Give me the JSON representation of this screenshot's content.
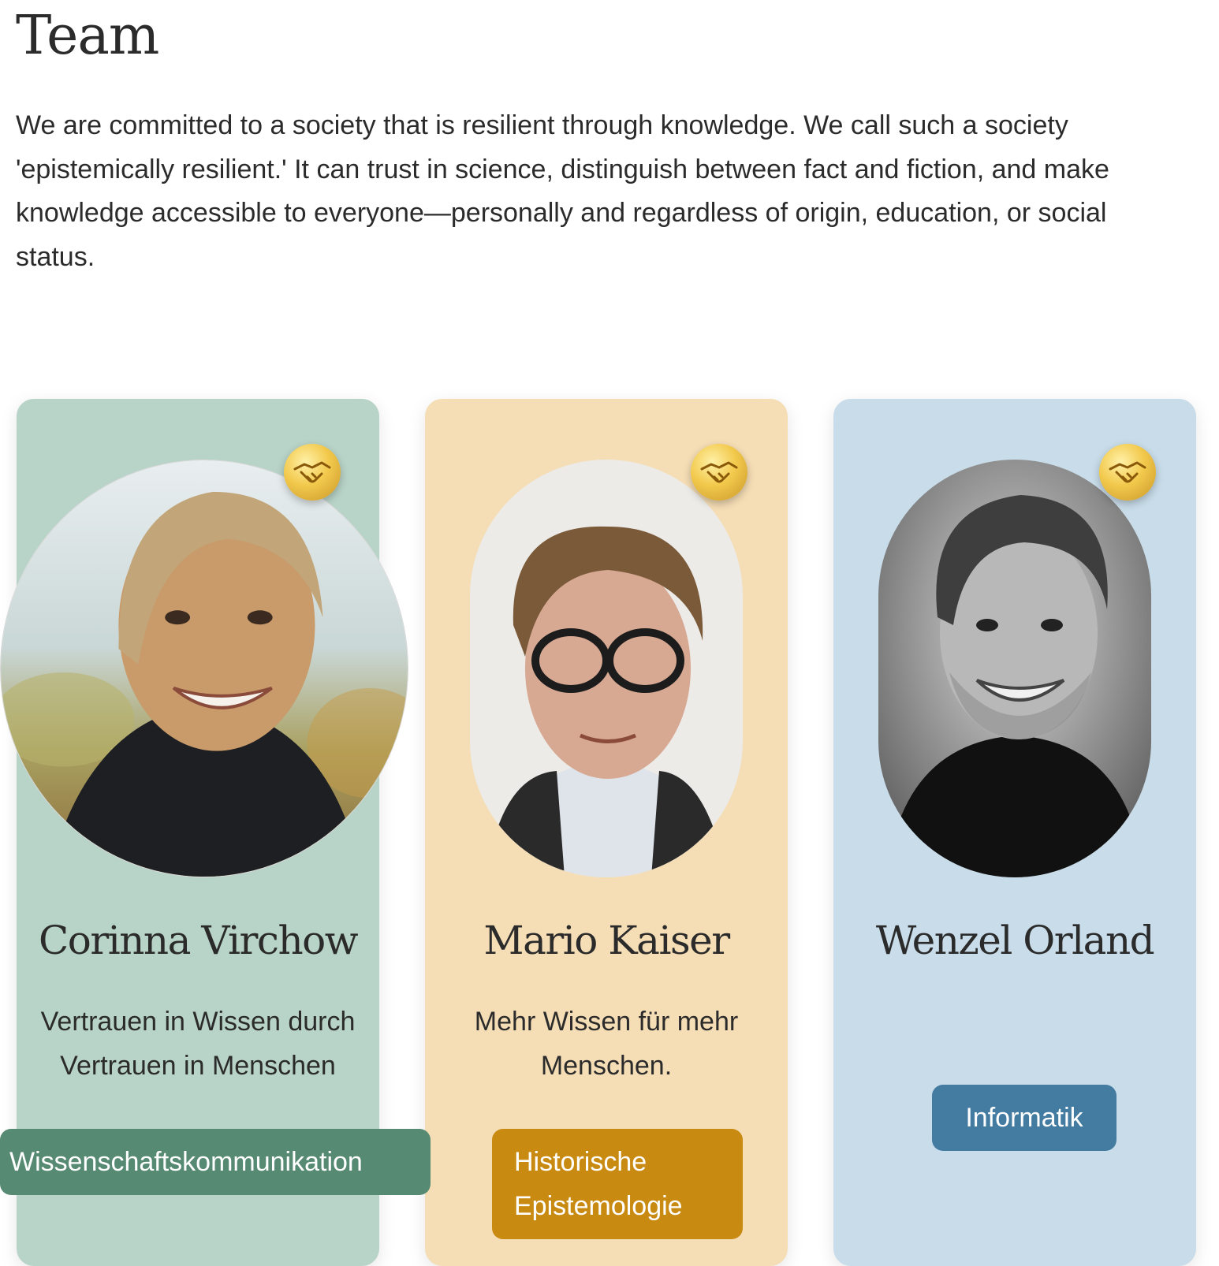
{
  "page": {
    "title": "Team",
    "intro": "We are committed to a society that is resilient through knowledge. We call such a society 'epistemically resilient.' It can trust in science, distinguish between fact and fiction, and make knowledge accessible to everyone—personally and regardless of origin, education, or social status."
  },
  "colors": {
    "card_green": "#b8d3c8",
    "card_sand": "#f5ddb5",
    "card_blue": "#c8dce9",
    "tag_green": "#578a73",
    "tag_orange": "#c88a10",
    "tag_blue": "#437ba1",
    "medal_gold": "#f2c94c"
  },
  "team": [
    {
      "name": "Corinna Virchow",
      "motto": "Vertrauen in Wissen durch Vertrauen in Menschen",
      "tag": "Wissenschaftskommunikation",
      "badge_icon": "handshake-icon"
    },
    {
      "name": "Mario Kaiser",
      "motto": "Mehr Wissen für mehr Menschen.",
      "tag": "Historische Epistemologie",
      "badge_icon": "handshake-icon"
    },
    {
      "name": "Wenzel Orland",
      "motto": "",
      "tag": "Informatik",
      "badge_icon": "handshake-icon"
    }
  ]
}
